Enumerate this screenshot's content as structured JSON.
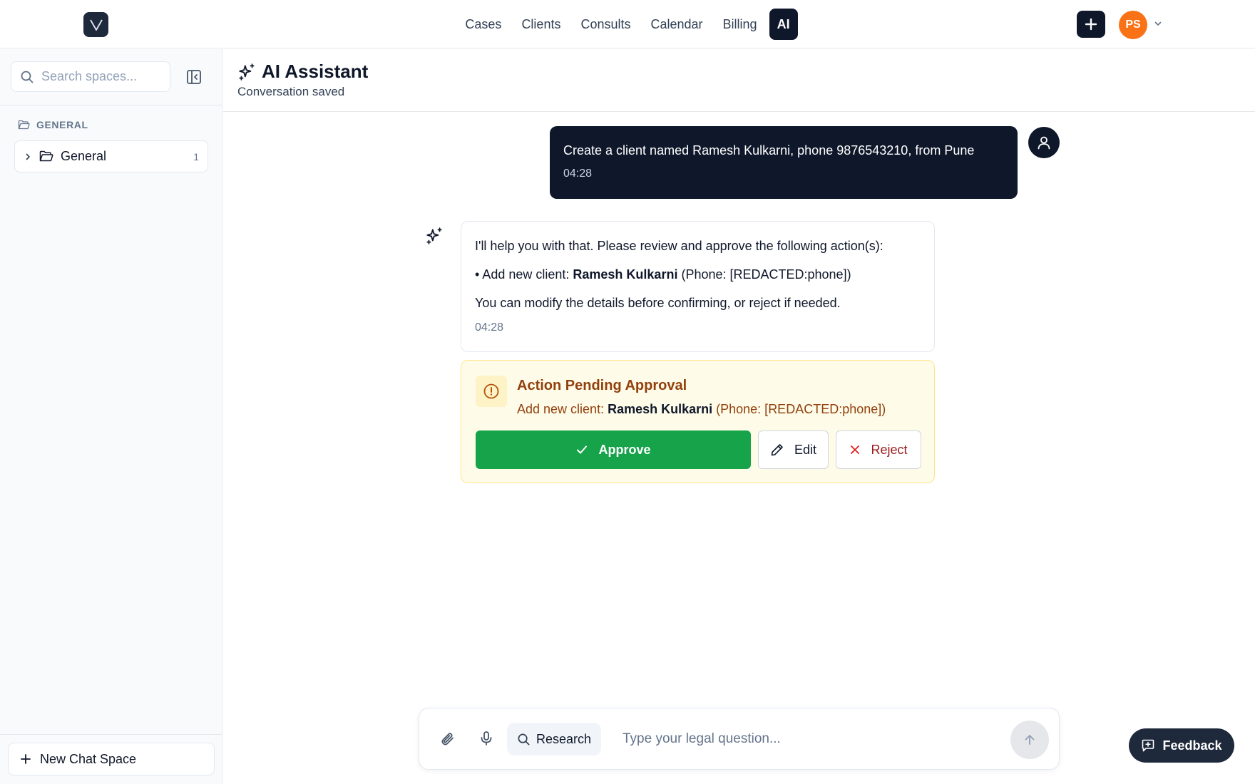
{
  "nav": {
    "items": [
      {
        "label": "Cases"
      },
      {
        "label": "Clients"
      },
      {
        "label": "Consults"
      },
      {
        "label": "Calendar"
      },
      {
        "label": "Billing"
      },
      {
        "label": "AI",
        "active": true
      }
    ]
  },
  "user": {
    "initials": "PS",
    "avatar_color": "#f97316"
  },
  "sidebar": {
    "search_placeholder": "Search spaces...",
    "section_label": "GENERAL",
    "folders": [
      {
        "name": "General",
        "count": "1"
      }
    ],
    "new_space_label": "New Chat Space"
  },
  "header": {
    "title": "AI Assistant",
    "subtitle": "Conversation saved"
  },
  "messages": {
    "user": {
      "text": "Create a client named Ramesh Kulkarni, phone 9876543210, from Pune",
      "time": "04:28"
    },
    "assistant": {
      "intro": "I'll help you with that. Please review and approve the following action(s):",
      "bullet_prefix": "• Add new client: ",
      "bullet_name": "Ramesh Kulkarni",
      "bullet_suffix": " (Phone: [REDACTED:phone])",
      "outro": "You can modify the details before confirming, or reject if needed.",
      "time": "04:28"
    }
  },
  "approval": {
    "title": "Action Pending Approval",
    "detail_prefix": "Add new client: ",
    "detail_name": "Ramesh Kulkarni",
    "detail_suffix": " (Phone: [REDACTED:phone])",
    "approve_label": "Approve",
    "edit_label": "Edit",
    "reject_label": "Reject",
    "approve_color": "#16a34a"
  },
  "composer": {
    "research_label": "Research",
    "placeholder": "Type your legal question..."
  },
  "feedback": {
    "label": "Feedback"
  }
}
